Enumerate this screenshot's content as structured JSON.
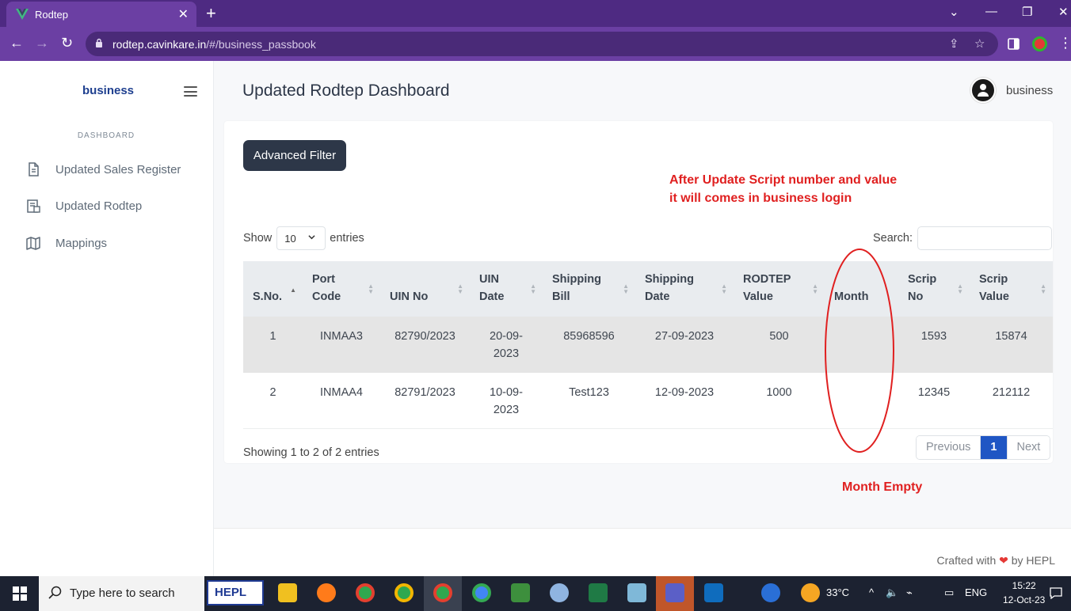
{
  "browser": {
    "tab_title": "Rodtep",
    "tab_close": "✕",
    "new_tab": "+",
    "url_host": "rodtep.cavinkare.in",
    "url_path": "/#/business_passbook"
  },
  "sidebar": {
    "brand": "business",
    "section_label": "DASHBOARD",
    "items": [
      {
        "label": "Updated Sales Register",
        "icon": "document-icon"
      },
      {
        "label": "Updated Rodtep",
        "icon": "receipt-icon"
      },
      {
        "label": "Mappings",
        "icon": "map-icon"
      }
    ]
  },
  "header": {
    "title": "Updated Rodtep Dashboard",
    "user": "business"
  },
  "toolbar": {
    "advanced_filter": "Advanced Filter"
  },
  "annotations": {
    "note_line1": "After Update Script number and value",
    "note_line2": "it will comes in business login",
    "month_note": "Month Empty",
    "color": "#e02020"
  },
  "table_controls": {
    "show_label": "Show",
    "page_length": "10",
    "entries_label": "entries",
    "search_label": "Search:"
  },
  "table": {
    "columns": [
      [
        "S.No.",
        ""
      ],
      [
        "Port",
        "Code"
      ],
      [
        "UIN No",
        ""
      ],
      [
        "UIN",
        "Date"
      ],
      [
        "Shipping",
        "Bill"
      ],
      [
        "Shipping",
        "Date"
      ],
      [
        "RODTEP",
        "Value"
      ],
      [
        "Month",
        ""
      ],
      [
        "Scrip",
        "No"
      ],
      [
        "Scrip",
        "Value"
      ]
    ],
    "rows": [
      {
        "sno": "1",
        "port_code": "INMAA3",
        "uin_no": "82790/2023",
        "uin_date_1": "20-09-",
        "uin_date_2": "2023",
        "shipping_bill": "85968596",
        "shipping_date": "27-09-2023",
        "rodtep_value": "500",
        "month": "",
        "scrip_no": "1593",
        "scrip_value": "15874"
      },
      {
        "sno": "2",
        "port_code": "INMAA4",
        "uin_no": "82791/2023",
        "uin_date_1": "10-09-",
        "uin_date_2": "2023",
        "shipping_bill": "Test123",
        "shipping_date": "12-09-2023",
        "rodtep_value": "1000",
        "month": "",
        "scrip_no": "12345",
        "scrip_value": "212112"
      }
    ]
  },
  "pagination": {
    "info": "Showing 1 to 2 of 2 entries",
    "previous": "Previous",
    "current": "1",
    "next": "Next"
  },
  "footer": {
    "prefix": "Crafted with",
    "heart": "❤",
    "suffix": "by HEPL"
  },
  "taskbar": {
    "search_placeholder": "Type here to search",
    "hepl_label": "HEPL",
    "temperature": "33°C",
    "language": "ENG",
    "time": "15:22",
    "date": "12-Oct-23"
  },
  "colors": {
    "browser_frame": "#4e2a82",
    "brand": "#1e3f8f",
    "primary_button": "#2d3748",
    "pager_active": "#1f56c4"
  }
}
